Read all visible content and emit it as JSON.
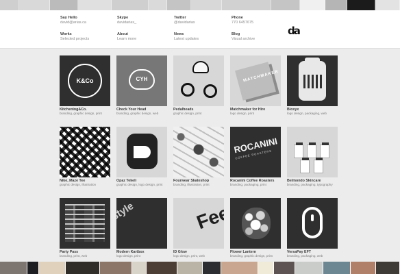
{
  "navigation": {
    "top_row": [
      {
        "label": "Say Hello",
        "value": "david@arias.ca"
      },
      {
        "label": "Skype",
        "value": "davidarias_"
      },
      {
        "label": "Twitter",
        "value": "@davidarias"
      },
      {
        "label": "Phone",
        "value": "770 6457675"
      }
    ],
    "bottom_row": [
      {
        "label": "Works",
        "value": "Selected projects"
      },
      {
        "label": "About",
        "value": "Learn more"
      },
      {
        "label": "News",
        "value": "Latest updates"
      },
      {
        "label": "Blog",
        "value": "Visual archive"
      }
    ],
    "logo": "da"
  },
  "portfolio": [
    {
      "title": "Kitchening&Co.",
      "tags": "branding, graphic design, print",
      "thumb": "kco-logo-icon"
    },
    {
      "title": "Check Your Head",
      "tags": "branding, graphic design, web",
      "thumb": "speech-bubble-icon"
    },
    {
      "title": "Pedalheads",
      "tags": "graphic design, print",
      "thumb": "cyclist-icon"
    },
    {
      "title": "Matchmaker for Hire",
      "tags": "logo design, print",
      "thumb": "book-icon"
    },
    {
      "title": "Bioxyx",
      "tags": "logo design, packaging, web",
      "thumb": "bottle-icon"
    },
    {
      "title": "Nike, Maze Tee",
      "tags": "graphic design, illustration",
      "thumb": "maze-pattern-icon"
    },
    {
      "title": "Opaz Tekeli",
      "tags": "graphic design, logo design, print",
      "thumb": "logo-mark-icon"
    },
    {
      "title": "Fourwear Skateshop",
      "tags": "branding, illustration, print",
      "thumb": "sticker-pattern-icon"
    },
    {
      "title": "Rocanini Coffee Roasters",
      "tags": "branding, packaging, print",
      "thumb": "coffee-packaging-icon",
      "overlay": "ROCANINI",
      "subline": "COFFEE ROASTERS"
    },
    {
      "title": "Belmondo Skincare",
      "tags": "branding, packaging, typography",
      "thumb": "skincare-jars-icon"
    },
    {
      "title": "Party Pass",
      "tags": "branding, print, web",
      "thumb": "party-pass-icon"
    },
    {
      "title": "Modern Kartbox",
      "tags": "logo design, print",
      "thumb": "type-stack-icon",
      "overlay": "style"
    },
    {
      "title": "ID Glow",
      "tags": "logo design, print, web",
      "thumb": "type-posters-icon",
      "overlay": "Fee"
    },
    {
      "title": "Flower Lantern",
      "tags": "branding, graphic design, print",
      "thumb": "flower-icon"
    },
    {
      "title": "VersaPay EFT",
      "tags": "branding, packaging, web",
      "thumb": "mouse-icon"
    }
  ],
  "colors": {
    "page_background": "#ececec",
    "header_background": "#ffffff",
    "text": "#2f2f2f",
    "muted_text": "#8a8a8a",
    "thumbnail_dark": "#2f2f2f"
  },
  "decorative_strips": {
    "top": [
      "#cfcfcf",
      "#d9d9d9",
      "#bbbbbb",
      "#e0e0e0",
      "#cfcfcf",
      "#dadada",
      "#c4c4c4",
      "#d8d8d8",
      "#d1d1d1",
      "#c5c5c5",
      "#f0f0f0",
      "#b5b5b5",
      "#1b1b1b",
      "#e3e3e3"
    ],
    "bottom": [
      "#7d756f",
      "#1b1d20",
      "#e0d1bc",
      "#302c27",
      "#8c7667",
      "#d9d4ca",
      "#4c3d35",
      "#b9b4a6",
      "#2b2d30",
      "#c9a68f",
      "#f0ead8",
      "#5d5353",
      "#c9ccc8",
      "#6d8792",
      "#b18069",
      "#3e3b37"
    ]
  }
}
